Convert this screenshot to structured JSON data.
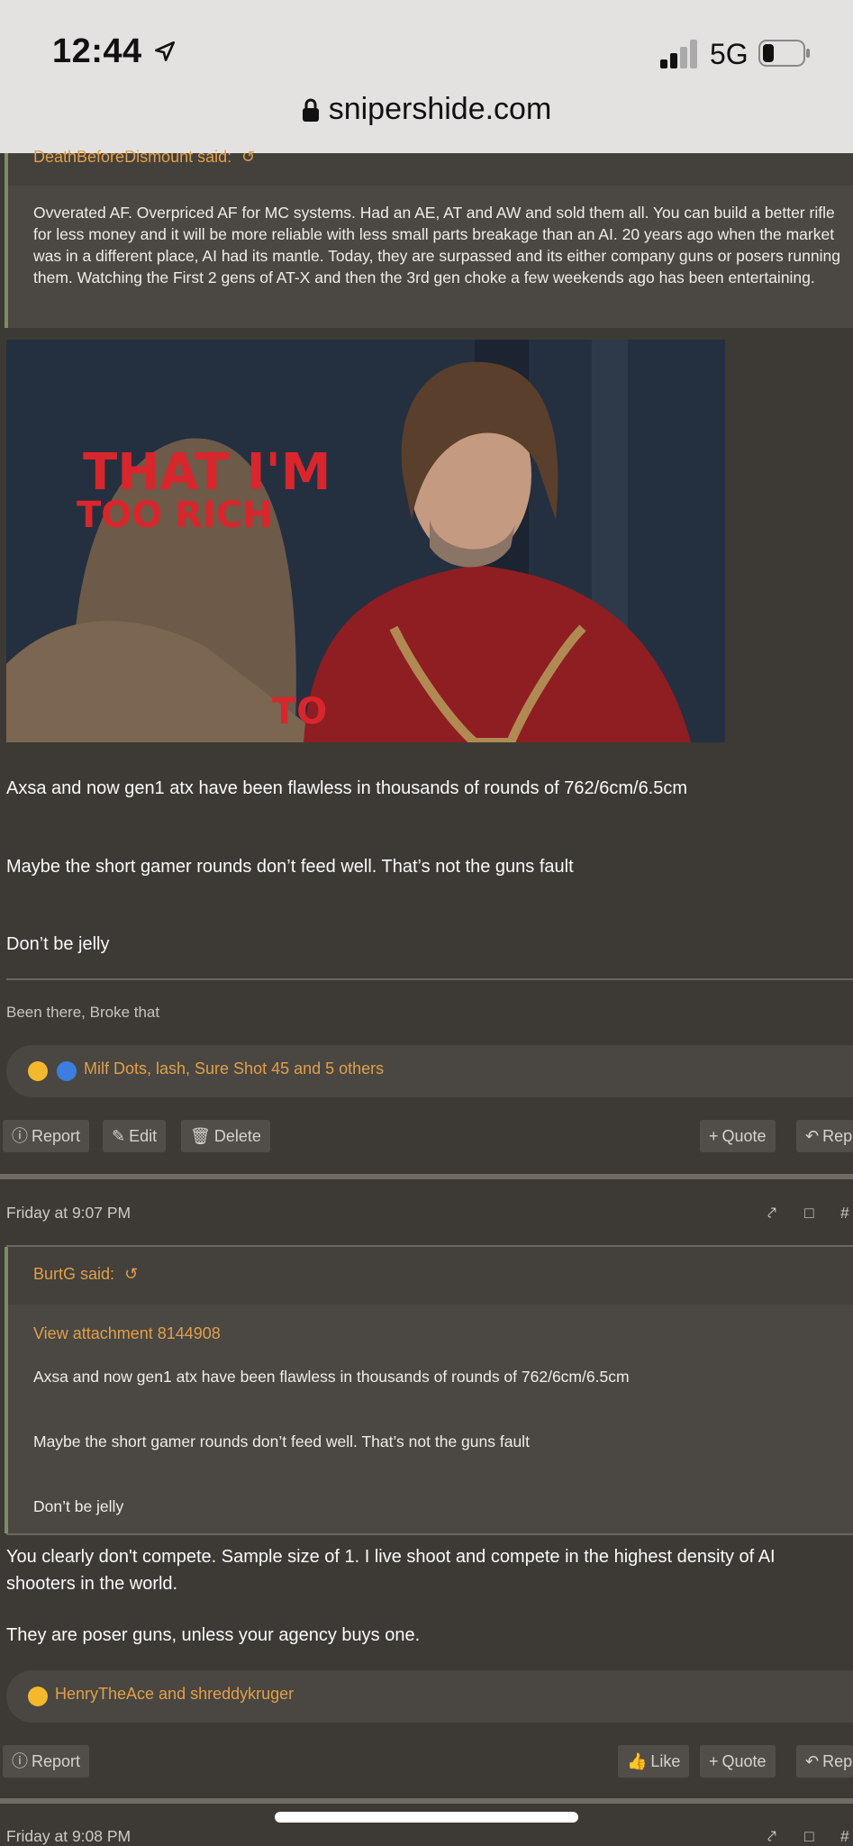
{
  "status_bar": {
    "time": "12:44",
    "network": "5G",
    "url": "snipershide.com"
  },
  "post1": {
    "quote_author": "DeathBeforeDismount said:",
    "quote_text": "Ovverated AF. Overpriced AF for MC systems. Had an AE, AT and AW and sold them all. You can build a better rifle for less money and it will be more reliable with less small parts breakage than an AI. 20 years ago when the market was in a different place, AI had its mantle. Today, they are surpassed and its either company guns or posers running them. Watching the First 2 gens of AT-X and then the 3rd gen choke a few weekends ago has been entertaining.",
    "gif_caption_line1": "THAT I'M",
    "gif_caption_line2": "TOO RICH",
    "gif_caption_bottom": "TO",
    "paragraphs": [
      "Axsa and now gen1 atx have been flawless in thousands of rounds of 762/6cm/6.5cm",
      "Maybe the short gamer rounds don’t feed well. That’s not the guns fault",
      "Don’t be jelly"
    ],
    "signature": "Been there, Broke that",
    "reactions": "Milf Dots, lash, Sure Shot 45 and 5 others",
    "actions": {
      "report": "Report",
      "edit": "Edit",
      "delete": "Delete",
      "quote": "Quote",
      "reply": "Rep"
    }
  },
  "post2": {
    "timestamp": "Friday at 9:07 PM",
    "post_number": "#",
    "quote_author": "BurtG said:",
    "attachment_link": "View attachment 8144908",
    "quote_paragraphs": [
      "Axsa and now gen1 atx have been flawless in thousands of rounds of 762/6cm/6.5cm",
      "Maybe the short gamer rounds don’t feed well. That’s not the guns fault",
      "Don’t be jelly"
    ],
    "paragraph1": "You clearly don't compete. Sample size of 1. I live shoot and compete in the highest density of AI shooters in the world.",
    "paragraph2": "They are poser guns, unless your agency buys one.",
    "reactions": "HenryTheAce and shreddykruger",
    "actions": {
      "report": "Report",
      "like": "Like",
      "quote": "Quote",
      "reply": "Rep"
    }
  },
  "post3": {
    "timestamp": "Friday at 9:08 PM",
    "post_number": "#"
  },
  "colors": {
    "accent": "#e0a04a",
    "background": "#3d3a36",
    "quote_border": "#7a8f5c"
  }
}
